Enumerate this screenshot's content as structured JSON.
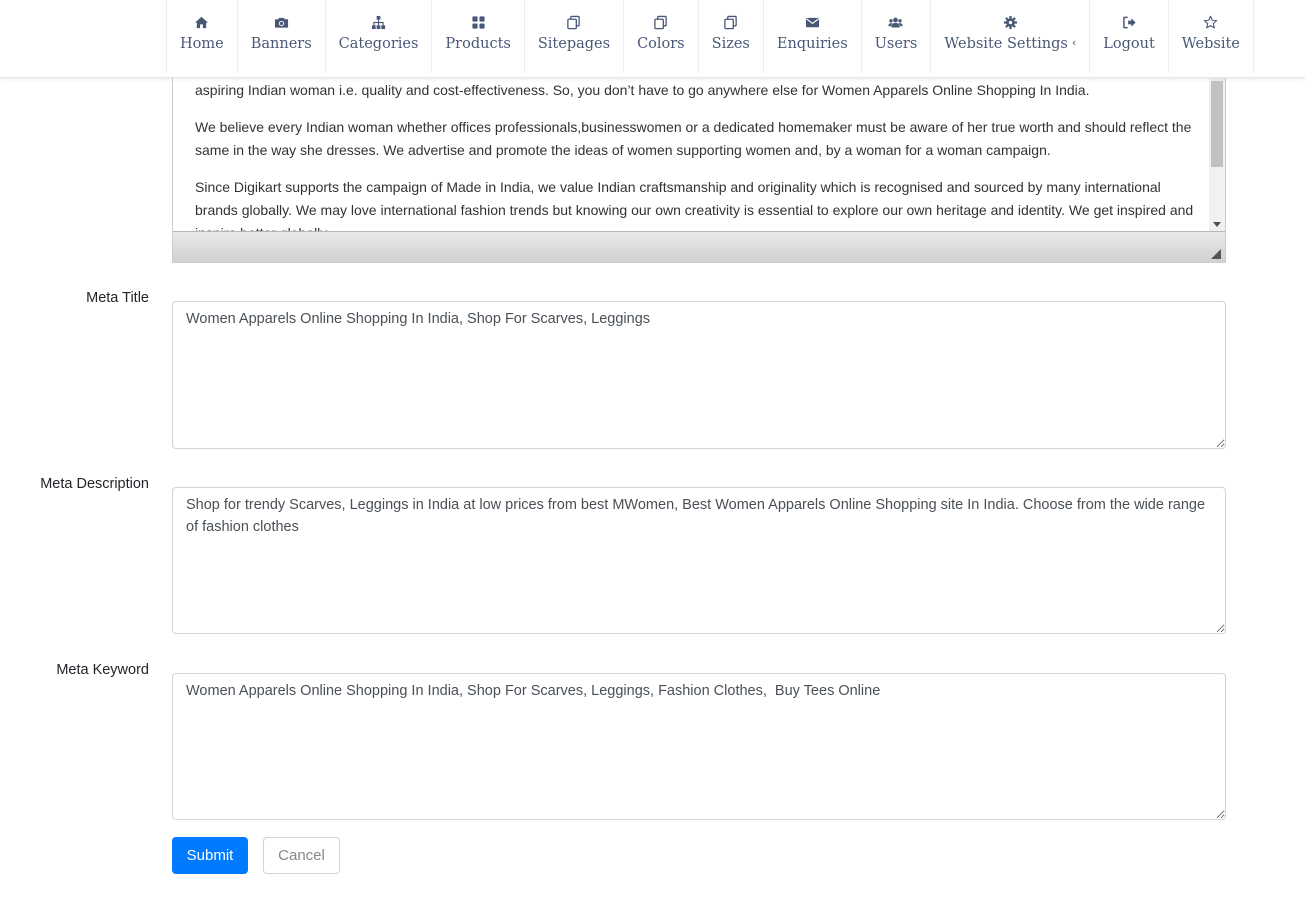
{
  "nav": {
    "items": [
      {
        "label": "Home",
        "icon": "home-icon"
      },
      {
        "label": "Banners",
        "icon": "camera-icon"
      },
      {
        "label": "Categories",
        "icon": "sitemap-icon"
      },
      {
        "label": "Products",
        "icon": "grid-icon"
      },
      {
        "label": "Sitepages",
        "icon": "copy-icon"
      },
      {
        "label": "Colors",
        "icon": "copy-icon"
      },
      {
        "label": "Sizes",
        "icon": "copy-icon"
      },
      {
        "label": "Enquiries",
        "icon": "envelope-icon"
      },
      {
        "label": "Users",
        "icon": "users-icon"
      },
      {
        "label": "Website Settings",
        "icon": "gear-icon",
        "caret": "‹"
      },
      {
        "label": "Logout",
        "icon": "sign-out-icon"
      },
      {
        "label": "Website",
        "icon": "star-icon"
      }
    ]
  },
  "editor": {
    "paragraphs": [
      "aspiring Indian woman i.e. quality and cost-effectiveness. So, you don’t have to go anywhere else for Women Apparels Online Shopping In India.",
      "We believe every Indian woman whether offices professionals,businesswomen or a dedicated homemaker must be aware of her true worth and should reflect the same in the way she dresses. We advertise and promote the ideas of women supporting women and, by a woman for a woman campaign.",
      "Since Digikart supports the campaign of Made in India, we value Indian craftsmanship and originality which is recognised and sourced by many international brands globally. We may love international fashion trends but knowing our own creativity is essential to explore our own heritage and identity. We get inspired and inspire better globally."
    ]
  },
  "form": {
    "meta_title": {
      "label": "Meta Title",
      "value": "Women Apparels Online Shopping In India, Shop For Scarves, Leggings"
    },
    "meta_description": {
      "label": "Meta Description",
      "value": "Shop for trendy Scarves, Leggings in India at low prices from best MWomen, Best Women Apparels Online Shopping site In India. Choose from the wide range of fashion clothes"
    },
    "meta_keyword": {
      "label": "Meta Keyword",
      "value": "Women Apparels Online Shopping In India, Shop For Scarves, Leggings, Fashion Clothes,  Buy Tees Online"
    },
    "submit_label": "Submit",
    "cancel_label": "Cancel"
  },
  "colors": {
    "nav_text": "#4a5878",
    "primary": "#007bff"
  }
}
